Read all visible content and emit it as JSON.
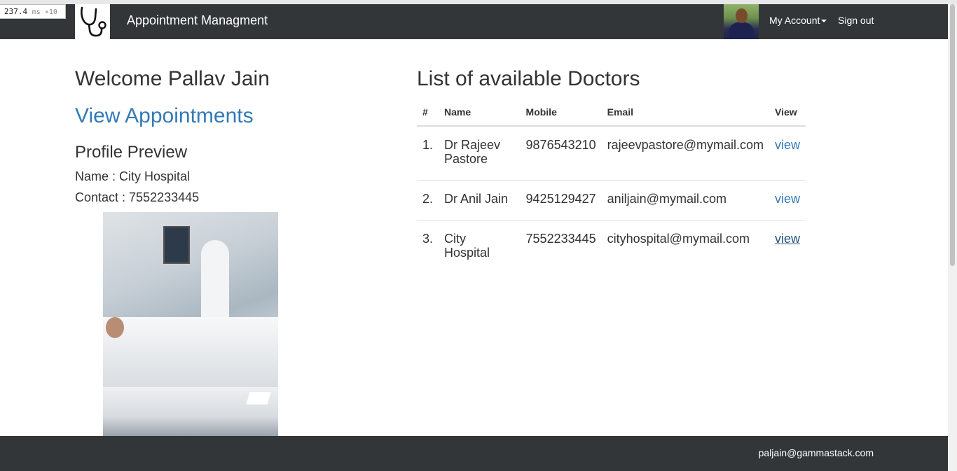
{
  "perf": {
    "value": "237.4",
    "unit": "ms ×10"
  },
  "header": {
    "logo_icon": "stethoscope-icon",
    "brand": "Appointment Managment",
    "account_label": "My Account",
    "signout_label": "Sign out"
  },
  "left": {
    "welcome": "Welcome Pallav Jain",
    "view_appointments": "View Appointments",
    "profile_title": "Profile Preview",
    "name_line": "Name : City Hospital",
    "contact_line": "Contact : 7552233445"
  },
  "doctors": {
    "title": "List of available Doctors",
    "columns": [
      "#",
      "Name",
      "Mobile",
      "Email",
      "View"
    ],
    "rows": [
      {
        "num": "1.",
        "name": "Dr Rajeev Pastore",
        "mobile": "9876543210",
        "email": "rajeevpastore@mymail.com",
        "view": "view"
      },
      {
        "num": "2.",
        "name": "Dr Anil Jain",
        "mobile": "9425129427",
        "email": "aniljain@mymail.com",
        "view": "view"
      },
      {
        "num": "3.",
        "name": "City Hospital",
        "mobile": "7552233445",
        "email": "cityhospital@mymail.com",
        "view": "view"
      }
    ]
  },
  "footer": {
    "email": "paljain@gammastack.com"
  },
  "colors": {
    "navbar": "#323638",
    "link": "#337ab7",
    "link_hover": "#23527c"
  }
}
